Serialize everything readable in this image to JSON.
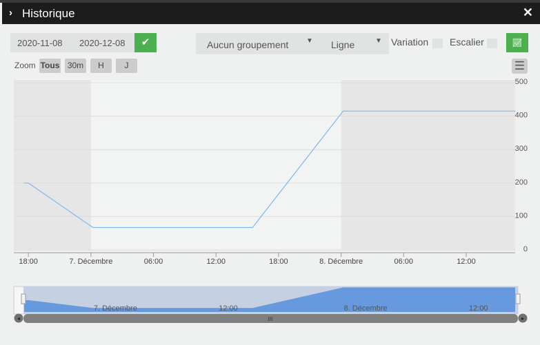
{
  "title": "Historique",
  "controls": {
    "date_start": "2020-11-08",
    "date_end": "2020-12-08",
    "grouping": "Aucun groupement",
    "chart_type": "Ligne",
    "variation_label": "Variation",
    "stair_label": "Escalier"
  },
  "zoom": {
    "label": "Zoom",
    "buttons": [
      "Tous",
      "30m",
      "H",
      "J"
    ]
  },
  "chart_data": {
    "type": "line",
    "x_unit": "hours since 6 Dec 18:00",
    "x_ticks": [
      {
        "h": 0,
        "label": "18:00"
      },
      {
        "h": 6,
        "label": "7. Décembre"
      },
      {
        "h": 12,
        "label": "06:00"
      },
      {
        "h": 18,
        "label": "12:00"
      },
      {
        "h": 24,
        "label": "18:00"
      },
      {
        "h": 30,
        "label": "8. Décembre"
      },
      {
        "h": 36,
        "label": "06:00"
      },
      {
        "h": 42,
        "label": "12:00"
      }
    ],
    "y_ticks": [
      0,
      100,
      200,
      300,
      400,
      500
    ],
    "ylim": [
      0,
      500
    ],
    "xlim": [
      -1.4,
      46.7
    ],
    "points": [
      [
        -0.4,
        200
      ],
      [
        0,
        200
      ],
      [
        6.2,
        67
      ],
      [
        21.5,
        67
      ],
      [
        30.2,
        415
      ],
      [
        46.7,
        415
      ]
    ],
    "night_bands": [
      [
        -1.4,
        6
      ],
      [
        30,
        46.7
      ]
    ],
    "navigator_labels": [
      {
        "h": 6,
        "label": "7. Décembre"
      },
      {
        "h": 18,
        "label": "12:00"
      },
      {
        "h": 30,
        "label": "8. Décembre"
      },
      {
        "h": 42,
        "label": "12:00"
      }
    ],
    "line_color": "#7cb5ec"
  }
}
